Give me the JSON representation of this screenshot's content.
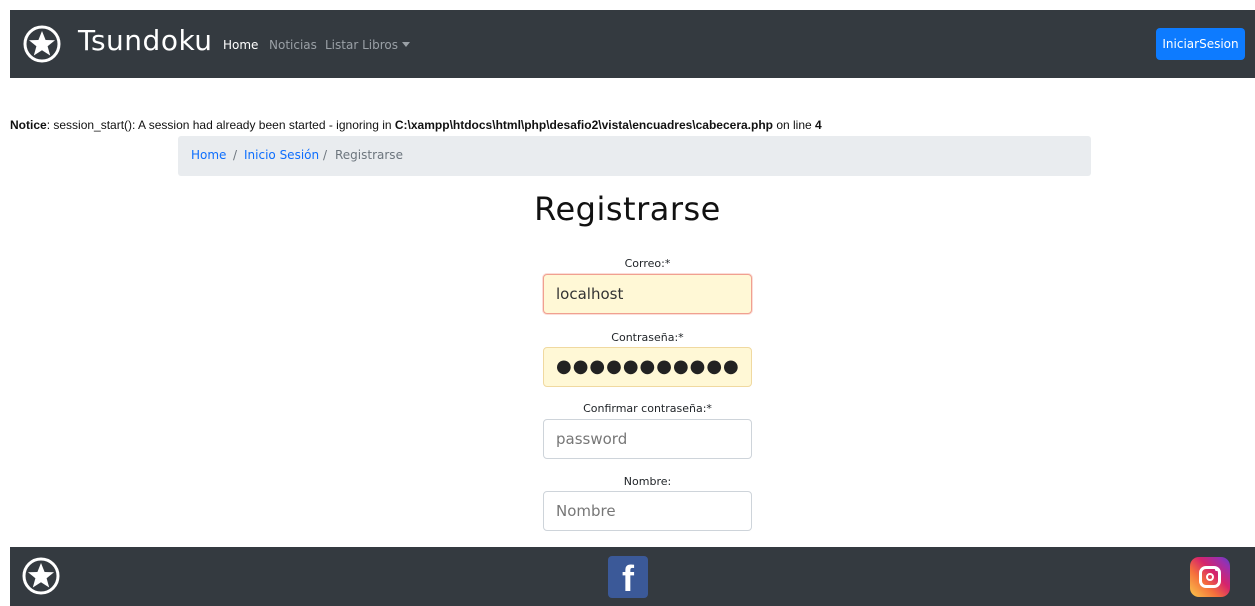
{
  "header": {
    "brand": "Tsundoku",
    "nav": [
      {
        "label": "Home",
        "active": true
      },
      {
        "label": "Noticias",
        "active": false
      },
      {
        "label": "Listar Libros",
        "active": false
      }
    ],
    "login_button": "IniciarSesion",
    "accent_color": "#0d7bff"
  },
  "notice": {
    "prefix": "Notice",
    "message": ": session_start(): A session had already been started - ignoring in ",
    "path": "C:\\xampp\\htdocs\\html\\php\\desafio2\\vista\\encuadres\\cabecera.php",
    "suffix": " on line ",
    "line": "4"
  },
  "breadcrumb": {
    "items": [
      {
        "label": "Home",
        "link": true
      },
      {
        "label": "Inicio Sesión",
        "link": true
      },
      {
        "label": "Registrarse",
        "link": false
      }
    ],
    "separator": "/"
  },
  "form": {
    "title": "Registrarse",
    "email": {
      "label": "Correo:*",
      "value": "localhost"
    },
    "password": {
      "label": "Contraseña:*",
      "masked_value": "●●●●●●●●●●●"
    },
    "confirm": {
      "label": "Confirmar contraseña:*",
      "placeholder": "password"
    },
    "name": {
      "label": "Nombre:",
      "placeholder": "Nombre"
    }
  },
  "footer": {
    "icons": [
      "star-logo-icon",
      "facebook-icon",
      "instagram-icon"
    ],
    "facebook_glyph": "f"
  }
}
